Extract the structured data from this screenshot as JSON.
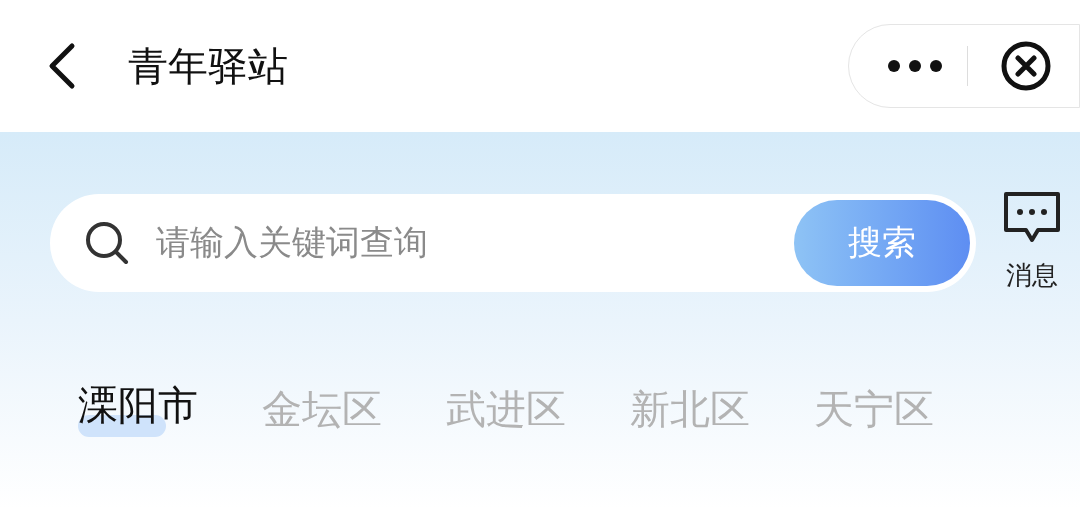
{
  "header": {
    "title": "青年驿站"
  },
  "search": {
    "placeholder": "请输入关键词查询",
    "button": "搜索"
  },
  "messages": {
    "label": "消息"
  },
  "tabs": [
    {
      "label": "溧阳市",
      "selected": true
    },
    {
      "label": "金坛区",
      "selected": false
    },
    {
      "label": "武进区",
      "selected": false
    },
    {
      "label": "新北区",
      "selected": false
    },
    {
      "label": "天宁区",
      "selected": false
    }
  ]
}
